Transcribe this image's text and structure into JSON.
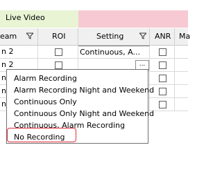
{
  "band": {
    "live_video": "Live Video"
  },
  "columns": {
    "stream": "eam",
    "roi": "ROI",
    "setting": "Setting",
    "anr": "ANR",
    "more": "Ma"
  },
  "rows": [
    {
      "stream": "n 2",
      "setting": "Continuous, A..."
    },
    {
      "stream": "n 2"
    },
    {
      "stream": "n 2"
    },
    {
      "stream": "n 2"
    },
    {
      "stream": "n 2"
    }
  ],
  "ellipsis_label": "...",
  "dropdown": {
    "options": [
      "Alarm Recording",
      "Alarm Recording Night and Weekend",
      "Continuous Only",
      "Continuous Only Night and Weekend",
      "Continuous, Alarm Recording",
      "No Recording"
    ],
    "highlighted": "No Recording",
    "highlight_color": "#e0313c"
  }
}
